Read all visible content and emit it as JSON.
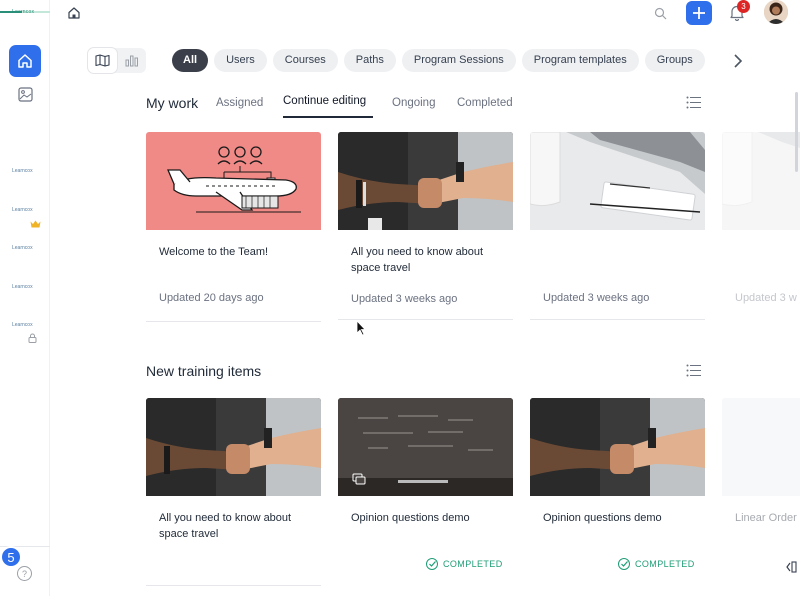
{
  "app": {
    "logo_text": "Learncox",
    "rail_apps": [
      "Learncox",
      "Learncox",
      "Learncox",
      "Learncox",
      "Learncox"
    ],
    "notification_badge_left": "5",
    "help_label": "?"
  },
  "topbar": {
    "notifications_count": "3"
  },
  "filters": {
    "chips": [
      "All",
      "Users",
      "Courses",
      "Paths",
      "Program Sessions",
      "Program templates",
      "Groups"
    ],
    "active": "All"
  },
  "my_work": {
    "title": "My work",
    "tabs": [
      "Assigned",
      "Continue editing",
      "Ongoing",
      "Completed"
    ],
    "active_tab": "Continue editing",
    "cards": [
      {
        "title": "Welcome to the Team!",
        "meta": "Updated 20 days ago",
        "image": "airplane-illustration"
      },
      {
        "title": "All you need to know about space travel",
        "meta": "Updated 3 weeks ago",
        "image": "fist-bump-photo"
      },
      {
        "title": "",
        "meta": "Updated 3 weeks ago",
        "image": "laptop-desk-photo"
      },
      {
        "title": "",
        "meta": "Updated 3 w",
        "image": "laptop-desk-photo"
      }
    ]
  },
  "new_training": {
    "title": "New training items",
    "cards": [
      {
        "title": "All you need to know about space travel",
        "status": "",
        "image": "fist-bump-photo"
      },
      {
        "title": "Opinion questions demo",
        "status": "COMPLETED",
        "image": "chalkboard-photo"
      },
      {
        "title": "Opinion questions demo",
        "status": "COMPLETED",
        "image": "fist-bump-photo"
      },
      {
        "title": "Linear Order",
        "status": "",
        "image": "blank"
      }
    ]
  },
  "colors": {
    "primary": "#2f6feb",
    "active_chip": "#3a3f4a",
    "completed": "#1f9d76",
    "badge": "#dc2626",
    "hero_pink": "#f08a87"
  }
}
